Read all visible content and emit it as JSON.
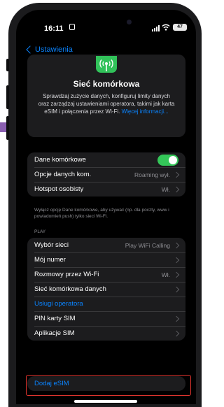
{
  "status_bar": {
    "time": "16:11",
    "battery": "47"
  },
  "nav": {
    "back_label": "Ustawienia"
  },
  "header": {
    "title": "Sieć komórkowa",
    "description": "Sprawdzaj zużycie danych, konfiguruj limity danych oraz zarządzaj ustawieniami operatora, takimi jak karta eSIM i połączenia przez Wi-Fi.",
    "more_link": "Więcej informacji..."
  },
  "group1": {
    "rows": [
      {
        "label": "Dane komórkowe",
        "toggle_on": true
      },
      {
        "label": "Opcje danych kom.",
        "value": "Roaming wył."
      },
      {
        "label": "Hotspot osobisty",
        "value": "Wł."
      }
    ],
    "footnote": "Wyłącz opcję Dane komórkowe, aby używać (np. dla poczty, www i powiadomień push) tylko sieci Wi-Fi."
  },
  "section_header": "PLAY",
  "group2": {
    "rows": [
      {
        "label": "Wybór sieci",
        "value": "Play WiFi Calling"
      },
      {
        "label": "Mój numer",
        "value": ""
      },
      {
        "label": "Rozmowy przez Wi-Fi",
        "value": "Wł."
      },
      {
        "label": "Sieć komórkowa danych",
        "value": ""
      },
      {
        "label": "Usługi operatora"
      },
      {
        "label": "PIN karty SIM",
        "value": ""
      },
      {
        "label": "Aplikacje SIM",
        "value": ""
      }
    ]
  },
  "group3": {
    "add_esim": "Dodaj eSIM"
  },
  "colors": {
    "accent": "#0a84ff",
    "toggle_on": "#34c759",
    "highlight": "#e0342e"
  }
}
